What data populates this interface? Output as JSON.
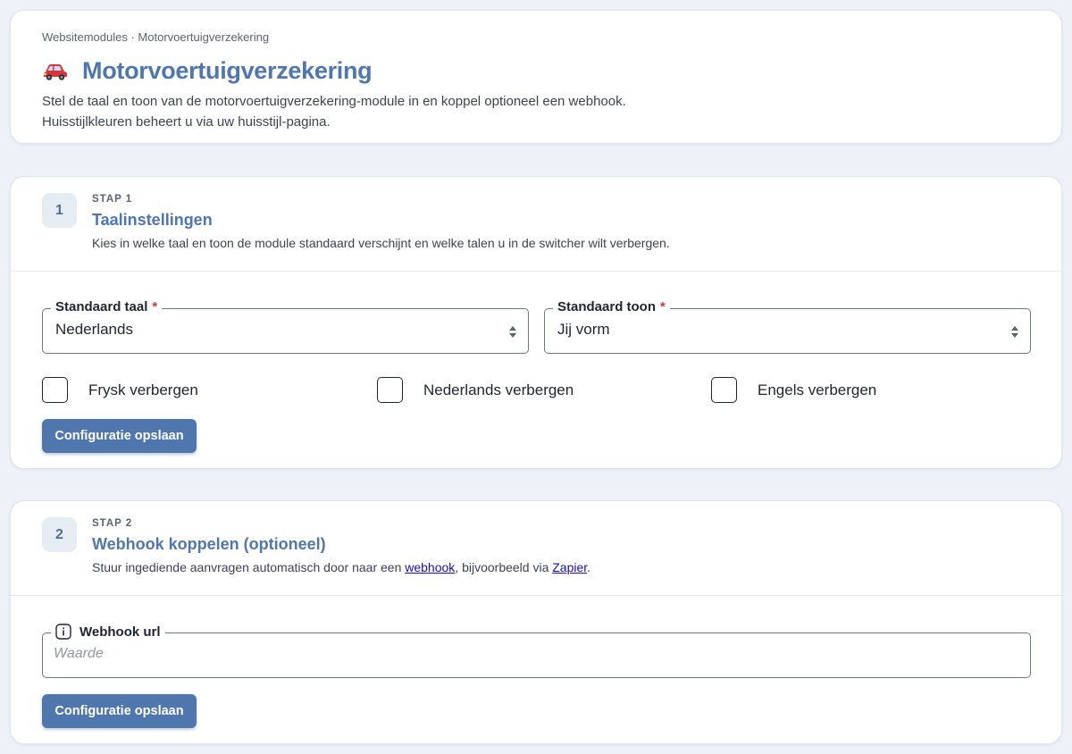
{
  "header": {
    "breadcrumb": "Websitemodules · Motorvoertuigverzekering",
    "title": "Motorvoertuigverzekering",
    "title_icon": "car-icon",
    "description_line1": "Stel de taal en toon van de motorvoertuigverzekering-module in en koppel optioneel een webhook.",
    "description_line2": "Huisstijlkleuren beheert u via uw huisstijl-pagina."
  },
  "step1": {
    "badge": "1",
    "eyebrow": "STAP 1",
    "title": "Taalinstellingen",
    "description": "Kies in welke taal en toon de module standaard verschijnt en welke talen u in de switcher wilt verbergen.",
    "language_select": {
      "label": "Standaard taal",
      "required_mark": "*",
      "value": "Nederlands"
    },
    "tone_select": {
      "label": "Standaard toon",
      "required_mark": "*",
      "value": "Jij vorm"
    },
    "checkboxes": [
      {
        "label": "Frysk verbergen",
        "checked": false
      },
      {
        "label": "Nederlands verbergen",
        "checked": false
      },
      {
        "label": "Engels verbergen",
        "checked": false
      }
    ],
    "save_label": "Configuratie opslaan"
  },
  "step2": {
    "badge": "2",
    "eyebrow": "STAP 2",
    "title": "Webhook koppelen (optioneel)",
    "description_prefix": "Stuur ingediende aanvragen automatisch door naar een ",
    "link_webhook": "webhook",
    "description_middle": ", bijvoorbeeld via ",
    "link_zapier": "Zapier",
    "description_suffix": ".",
    "webhook_field": {
      "label": "Webhook url",
      "placeholder": "Waarde",
      "value": "",
      "icon": "info-icon"
    },
    "save_label": "Configuratie opslaan"
  },
  "colors": {
    "accent": "#4f76ad",
    "page_background": "#eef2f8",
    "link": "#1a0dab",
    "required": "#d03a3a"
  }
}
